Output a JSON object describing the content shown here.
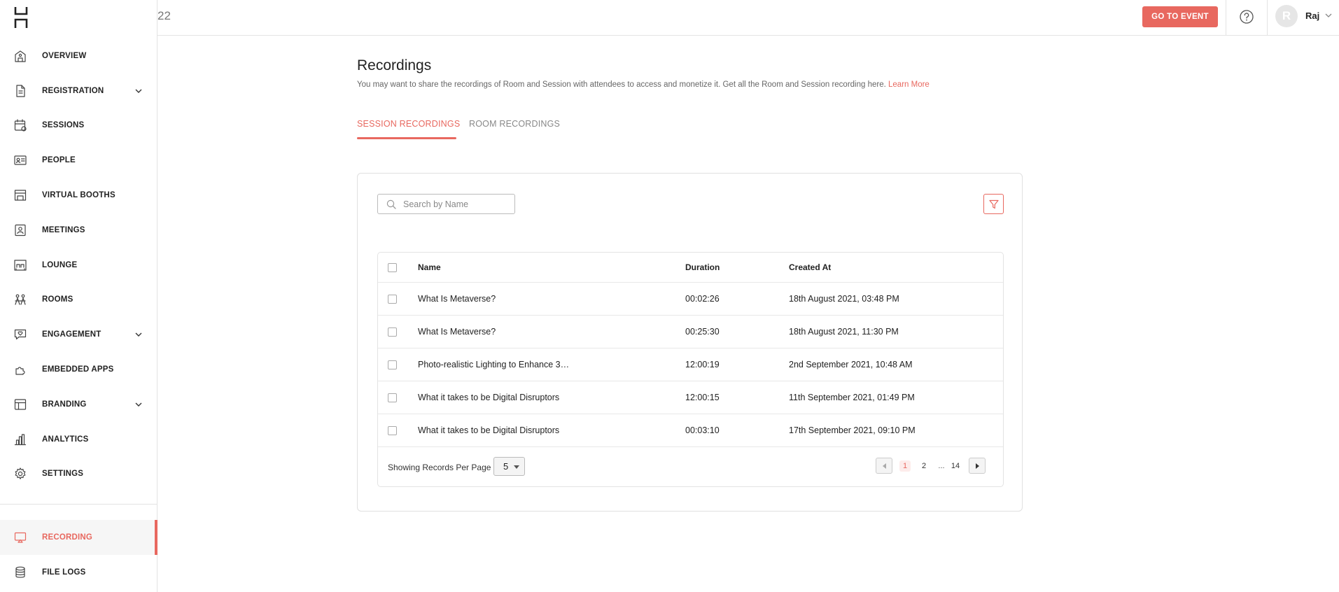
{
  "topbar": {
    "event_number": "22",
    "go_to_event": "GO TO EVENT",
    "avatar_initial": "R",
    "username": "Raj"
  },
  "sidebar": {
    "items": [
      {
        "label": "OVERVIEW",
        "icon": "building-icon",
        "has_children": false
      },
      {
        "label": "REGISTRATION",
        "icon": "document-icon",
        "has_children": true
      },
      {
        "label": "SESSIONS",
        "icon": "calendar-icon",
        "has_children": false
      },
      {
        "label": "PEOPLE",
        "icon": "id-card-icon",
        "has_children": false
      },
      {
        "label": "VIRTUAL BOOTHS",
        "icon": "booth-icon",
        "has_children": false
      },
      {
        "label": "MEETINGS",
        "icon": "meeting-icon",
        "has_children": false
      },
      {
        "label": "LOUNGE",
        "icon": "lounge-icon",
        "has_children": false
      },
      {
        "label": "ROOMS",
        "icon": "rooms-icon",
        "has_children": false
      },
      {
        "label": "ENGAGEMENT",
        "icon": "chat-heart-icon",
        "has_children": true
      },
      {
        "label": "EMBEDDED APPS",
        "icon": "puzzle-icon",
        "has_children": false
      },
      {
        "label": "BRANDING",
        "icon": "layout-icon",
        "has_children": true
      },
      {
        "label": "ANALYTICS",
        "icon": "bar-chart-icon",
        "has_children": false
      },
      {
        "label": "SETTINGS",
        "icon": "gear-icon",
        "has_children": false
      }
    ],
    "bottom_items": [
      {
        "label": "RECORDING",
        "icon": "screen-cast-icon",
        "active": true
      },
      {
        "label": "FILE LOGS",
        "icon": "database-icon",
        "active": false
      }
    ]
  },
  "main": {
    "title": "Recordings",
    "description": "You may want to share the recordings of Room and Session with attendees to access and monetize it. Get all the Room and Session recording here.",
    "learn_more": "Learn More",
    "tabs": [
      {
        "label": "SESSION RECORDINGS",
        "active": true
      },
      {
        "label": "ROOM RECORDINGS",
        "active": false
      }
    ],
    "search_placeholder": "Search by Name",
    "table": {
      "columns": [
        "Name",
        "Duration",
        "Created At"
      ],
      "rows": [
        {
          "name": "What Is Metaverse?",
          "duration": "00:02:26",
          "created_at": "18th August 2021, 03:48 PM"
        },
        {
          "name": "What Is Metaverse?",
          "duration": "00:25:30",
          "created_at": "18th August 2021, 11:30 PM"
        },
        {
          "name": "Photo-realistic Lighting to Enhance 3…",
          "duration": "12:00:19",
          "created_at": "2nd September 2021, 10:48 AM"
        },
        {
          "name": "What it takes to be Digital Disruptors",
          "duration": "12:00:15",
          "created_at": "11th September 2021, 01:49 PM"
        },
        {
          "name": "What it takes to be Digital Disruptors",
          "duration": "00:03:10",
          "created_at": "17th September 2021, 09:10 PM"
        }
      ]
    },
    "pagination": {
      "per_page_label": "Showing Records Per Page",
      "per_page": "5",
      "pages": [
        "1",
        "2",
        "...",
        "14"
      ],
      "current_page": "1"
    }
  },
  "colors": {
    "accent": "#e8685f",
    "border": "#e3e3e3",
    "text": "#222222"
  }
}
